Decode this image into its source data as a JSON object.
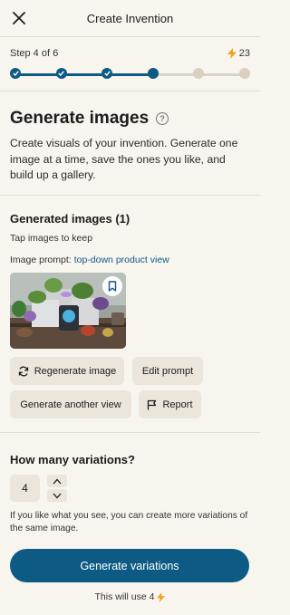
{
  "header": {
    "title": "Create Invention"
  },
  "progress": {
    "step_label": "Step 4 of 6",
    "credits": "23",
    "current_step": 4,
    "total_steps": 6
  },
  "intro": {
    "title": "Generate images",
    "description": "Create visuals of your invention. Generate one image at a time, save the ones you like, and build up a gallery."
  },
  "generated": {
    "title": "Generated images (1)",
    "hint": "Tap images to keep",
    "prompt_label": "Image prompt:",
    "prompt_value": "top-down product view",
    "buttons": {
      "regenerate": "Regenerate image",
      "edit_prompt": "Edit prompt",
      "another_view": "Generate another view",
      "report": "Report"
    }
  },
  "variations": {
    "title": "How many variations?",
    "count": "4",
    "note": "If you like what you see, you can create more variations of the same image."
  },
  "footer": {
    "primary_label": "Generate variations",
    "uses_label": "This will use 4"
  },
  "colors": {
    "accent": "#0d5a84",
    "bolt": "#f0a21a",
    "chip": "#ebe5db",
    "background": "#f8f5ef"
  }
}
